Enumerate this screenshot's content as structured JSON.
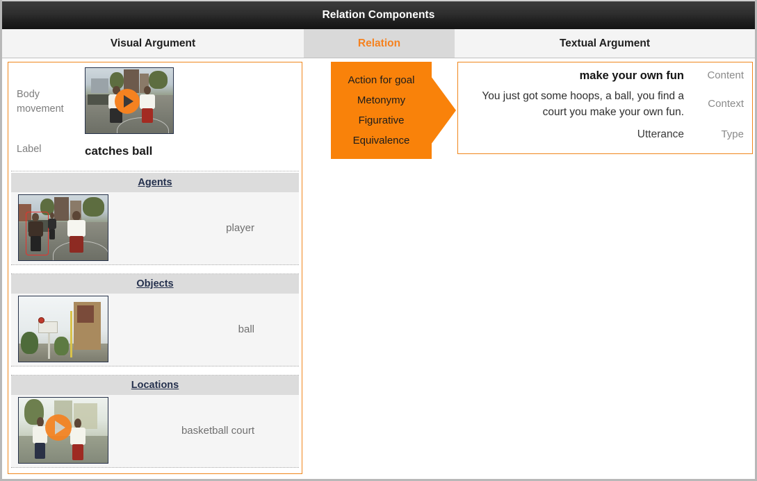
{
  "window": {
    "title": "Relation Components"
  },
  "tabs": [
    {
      "id": "visual",
      "label": "Visual Argument",
      "active": false
    },
    {
      "id": "relation",
      "label": "Relation",
      "active": true
    },
    {
      "id": "textual",
      "label": "Textual Argument",
      "active": false
    }
  ],
  "colors": {
    "accent_orange": "#f58220",
    "arrow_orange": "#f9820a",
    "panel_border": "#f0861b",
    "tab_active_bg": "#d9d9d9",
    "section_header_bg": "#dcdcdc",
    "section_header_text": "#24304d",
    "row_bg": "#f5f5f5",
    "muted_text": "#7d7d7d",
    "titlebar_text": "#ffffff"
  },
  "visual_argument": {
    "movement_label": "Body movement",
    "movement_thumbnail_alt": "street basketball players video frame",
    "movement_play_icon": "play-icon",
    "label_key": "Label",
    "label_value": "catches ball",
    "sections": [
      {
        "id": "agents",
        "heading": "Agents",
        "rows": [
          {
            "name": "player",
            "thumbnail_alt": "basketball player outlined in red",
            "has_play_icon": false
          }
        ]
      },
      {
        "id": "objects",
        "heading": "Objects",
        "rows": [
          {
            "name": "ball",
            "thumbnail_alt": "basketball in mid-air near hoop",
            "has_play_icon": false
          }
        ]
      },
      {
        "id": "locations",
        "heading": "Locations",
        "rows": [
          {
            "name": "basketball court",
            "thumbnail_alt": "outdoor basketball court video frame",
            "has_play_icon": true
          }
        ]
      }
    ]
  },
  "relation": {
    "items": [
      "Action for goal",
      "Metonymy",
      "Figurative",
      "Equivalence"
    ]
  },
  "textual_argument": {
    "content_value": "make your own fun",
    "content_key": "Content",
    "context_value": "You just got some hoops, a ball, you find a court you make your own fun.",
    "context_key": "Context",
    "type_value": "Utterance",
    "type_key": "Type"
  }
}
